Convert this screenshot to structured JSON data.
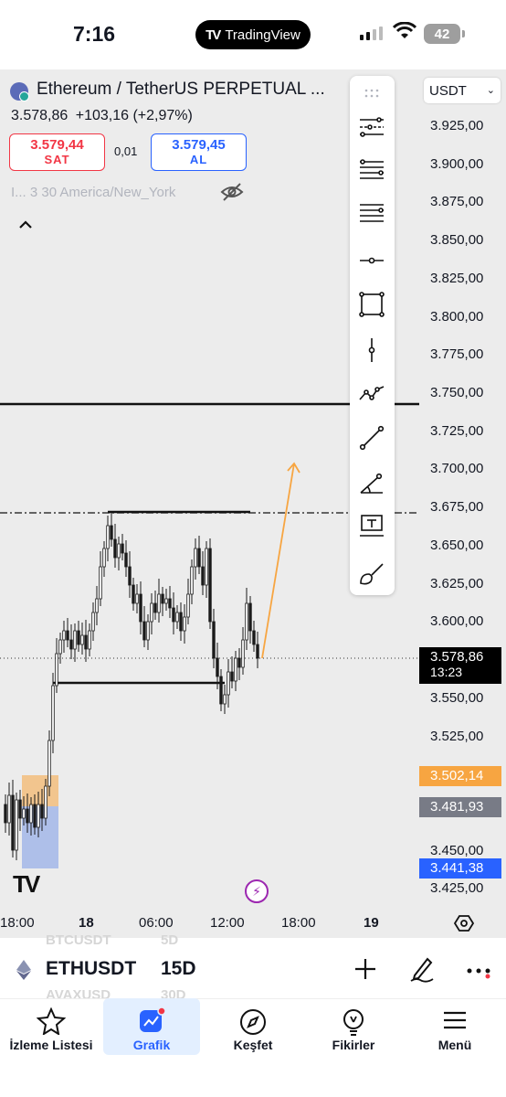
{
  "status_bar": {
    "time": "7:16",
    "pill_logo": "TV",
    "pill_text": "TradingView",
    "battery": "42"
  },
  "header": {
    "symbol_title": "Ethereum / TetherUS PERPETUAL ...",
    "last_price": "3.578,86",
    "change": "+103,16",
    "change_pct": "(+2,97%)",
    "sell_price": "3.579,44",
    "sell_label": "SAT",
    "spread": "0,01",
    "buy_price": "3.579,45",
    "buy_label": "AL",
    "indicator": "I... 3 30 America/New_York",
    "currency": "USDT"
  },
  "price_axis": [
    "3.925,00",
    "3.900,00",
    "3.875,00",
    "3.850,00",
    "3.825,00",
    "3.800,00",
    "3.775,00",
    "3.750,00",
    "3.725,00",
    "3.700,00",
    "3.675,00",
    "3.650,00",
    "3.625,00",
    "3.600,00",
    "3.550,00",
    "3.525,00",
    "3.450,00",
    "3.425,00"
  ],
  "price_labels": {
    "current": "3.578,86",
    "countdown": "13:23",
    "orange": "3.502,14",
    "gray": "3.481,93",
    "blue": "3.441,38"
  },
  "time_axis": [
    "18:00",
    "18",
    "06:00",
    "12:00",
    "18:00",
    "19"
  ],
  "toolbar_icons": [
    "grip-icon",
    "pitchfork-icon",
    "fib-retracement-icon",
    "parallel-channel-icon",
    "horizontal-ray-icon",
    "rectangle-icon",
    "vertical-line-icon",
    "path-icon",
    "trend-line-icon",
    "trend-angle-icon",
    "text-tool-icon",
    "brush-icon"
  ],
  "symbol_bar": {
    "ghost_top": "BTCUSDT",
    "ghost_top_int": "5D",
    "name": "ETHUSDT",
    "interval": "15D",
    "ghost_bottom": "AVAXUSD",
    "ghost_bottom_int": "30D"
  },
  "tabs": [
    {
      "label": "İzleme Listesi",
      "icon": "star-icon"
    },
    {
      "label": "Grafik",
      "icon": "chart-icon"
    },
    {
      "label": "Keşfet",
      "icon": "compass-icon"
    },
    {
      "label": "Fikirler",
      "icon": "lightbulb-icon"
    },
    {
      "label": "Menü",
      "icon": "menu-icon"
    }
  ],
  "colors": {
    "sell": "#f23645",
    "buy": "#2962ff",
    "orange": "#f7a541",
    "gray_label": "#787b86",
    "blue_label": "#2962ff",
    "current_label": "#000000",
    "candle": "#1a1a1a"
  }
}
